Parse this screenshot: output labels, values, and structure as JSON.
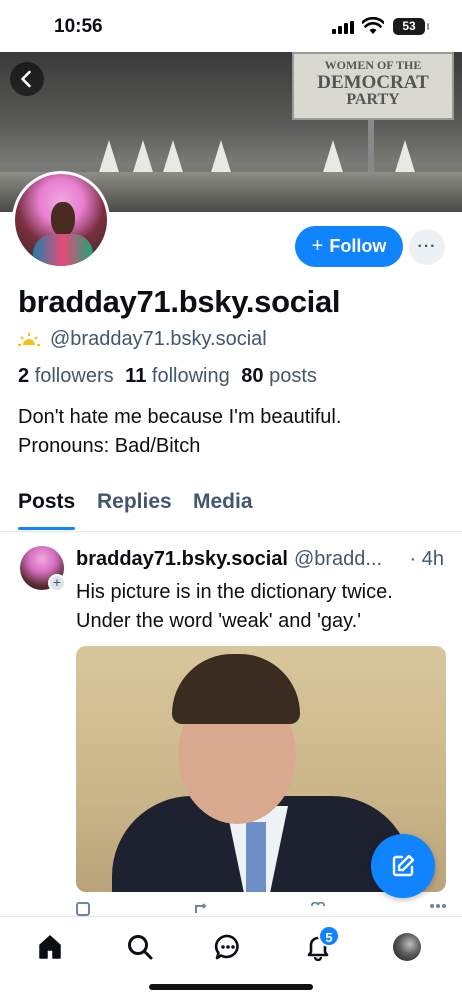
{
  "status_bar": {
    "time": "10:56",
    "battery": "53"
  },
  "banner": {
    "sign_line1": "WOMEN OF THE",
    "sign_line2": "DEMOCRAT",
    "sign_line3": "PARTY"
  },
  "profile": {
    "display_name": "bradday71.bsky.social",
    "handle": "@bradday71.bsky.social",
    "followers_count": "2",
    "followers_label": "followers",
    "following_count": "11",
    "following_label": "following",
    "posts_count": "80",
    "posts_label": "posts",
    "bio_line1": "Don't hate me because I'm beautiful.",
    "bio_line2": "Pronouns: Bad/Bitch",
    "follow_label": "Follow",
    "follow_icon": "+",
    "more_label": "···"
  },
  "tabs": [
    {
      "label": "Posts",
      "active": true
    },
    {
      "label": "Replies",
      "active": false
    },
    {
      "label": "Media",
      "active": false
    }
  ],
  "post": {
    "author": "bradday71.bsky.social",
    "handle": "@bradd...",
    "time": "· 4h",
    "text": "His picture is in the dictionary twice. Under the word 'weak' and 'gay.'",
    "add_icon": "+"
  },
  "nav": {
    "notification_badge": "5"
  },
  "icons": [
    "back-icon",
    "sun-icon",
    "compose-icon",
    "home-icon",
    "search-icon",
    "chat-icon",
    "bell-icon",
    "profile-avatar-icon"
  ],
  "colors": {
    "accent": "#1083fe",
    "muted": "#42566e"
  }
}
